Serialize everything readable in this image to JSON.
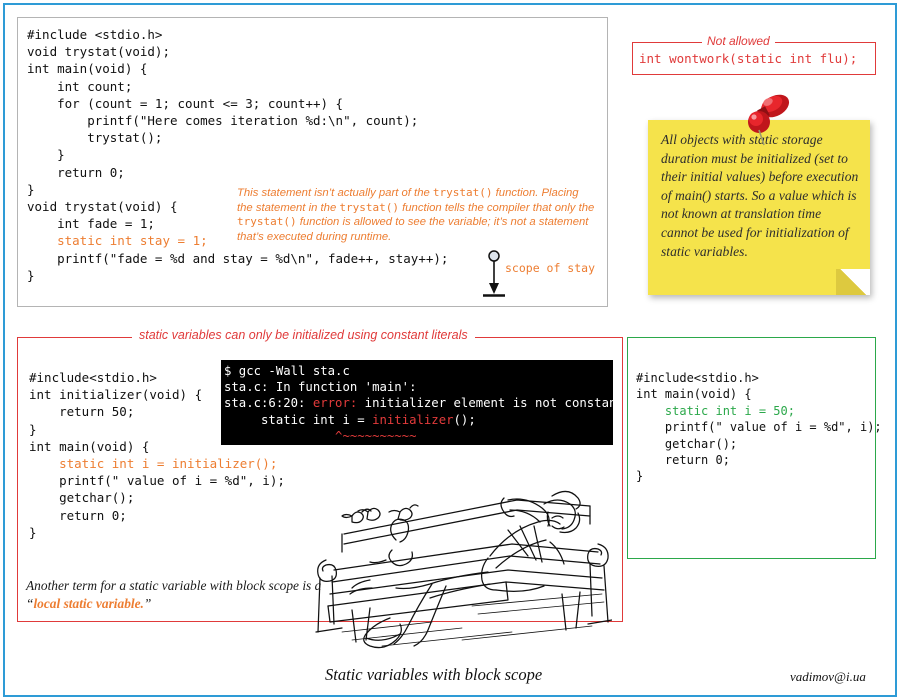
{
  "colors": {
    "frame_blue": "#2E9BD6",
    "accent_orange": "#ED7D31",
    "accent_red": "#E03A3A",
    "accent_green": "#2BA84A",
    "sticky_yellow": "#F5E34B",
    "terminal_bg": "#000000"
  },
  "main_program": {
    "lines": [
      "#include <stdio.h>",
      "void trystat(void);",
      "int main(void) {",
      "    int count;",
      "    for (count = 1; count <= 3; count++) {",
      "        printf(\"Here comes iteration %d:\\n\", count);",
      "        trystat();",
      "    }",
      "    return 0;",
      "}",
      "void trystat(void) {",
      "    int fade = 1;",
      "    static int stay = 1;",
      "    printf(\"fade = %d and stay = %d\\n\", fade++, stay++);",
      "}"
    ],
    "highlight_line": "    static int stay = 1;"
  },
  "annotation": {
    "text_part1": "This statement isn’t actually part of the ",
    "mono1": "trystat()",
    "text_part2": " function. Placing the statement in the ",
    "mono2": "trystat()",
    "text_part3": " function tells the compiler that only the ",
    "mono3": "trystat()",
    "text_part4": " function is allowed to see the variable; it’s not a statement that’s executed during runtime.",
    "scope_label": "scope of stay"
  },
  "not_allowed": {
    "title": "Not allowed",
    "code": "int wontwork(static int flu);"
  },
  "sticky_note": {
    "text": "All objects with static storage duration must be initialized (set to their initial values) before execution of main() starts. So a value which is not known at translation time cannot be used for initialization of static variables."
  },
  "red_panel": {
    "title": "static variables can only be initialized using constant literals",
    "code_lines": [
      "#include<stdio.h>",
      "int initializer(void) {",
      "    return 50;",
      "}",
      "int main(void) {",
      "    static int i = initializer();",
      "    printf(\" value of i = %d\", i);",
      "    getchar();",
      "    return 0;",
      "}"
    ],
    "highlight_line": "    static int i = initializer();",
    "caption_prefix": "Another term for a static variable with block scope is a “",
    "caption_highlight": "local static variable.",
    "caption_suffix": "”"
  },
  "terminal": {
    "line1": "$ gcc -Wall sta.c",
    "line2": "sta.c: In function 'main':",
    "line3_prefix": "sta.c:6:20: ",
    "line3_error": "error:",
    "line3_rest": " initializer element is not constant",
    "line4_prefix": "     static int i = ",
    "line4_highlight": "initializer",
    "line4_suffix": "();",
    "line5_squiggle": "               ^~~~~~~~~~~"
  },
  "green_panel": {
    "code_lines": [
      "#include<stdio.h>",
      "int main(void) {",
      "    static int i = 50;",
      "    printf(\" value of i = %d\", i);",
      "    getchar();",
      "    return 0;",
      "}"
    ],
    "highlight_line": "    static int i = 50;"
  },
  "footer": {
    "title": "Static variables with block scope",
    "signature": "vadimov@i.ua"
  }
}
